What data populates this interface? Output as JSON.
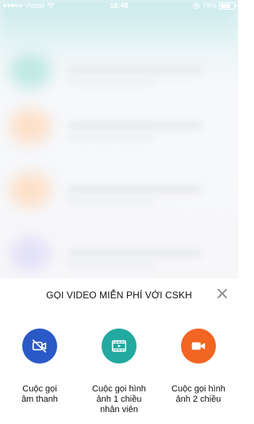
{
  "status_bar": {
    "carrier": "Viettel",
    "time": "16:48",
    "battery": "78%",
    "battery_level": 0.78
  },
  "sheet": {
    "title": "GỌI VIDEO MIỄN PHÍ VỚI CSKH",
    "close_icon": "close-icon",
    "options": [
      {
        "label": "Cuộc gọi\nâm thanh",
        "icon": "video-off-icon",
        "color": "#2a59c8"
      },
      {
        "label": "Cuộc gọi hình\nảnh 1 chiều\nnhân viên",
        "icon": "video-play-icon",
        "color": "#22a9a0"
      },
      {
        "label": "Cuộc gọi hình\nảnh 2 chiều",
        "icon": "video-camera-icon",
        "color": "#f26522"
      }
    ]
  }
}
